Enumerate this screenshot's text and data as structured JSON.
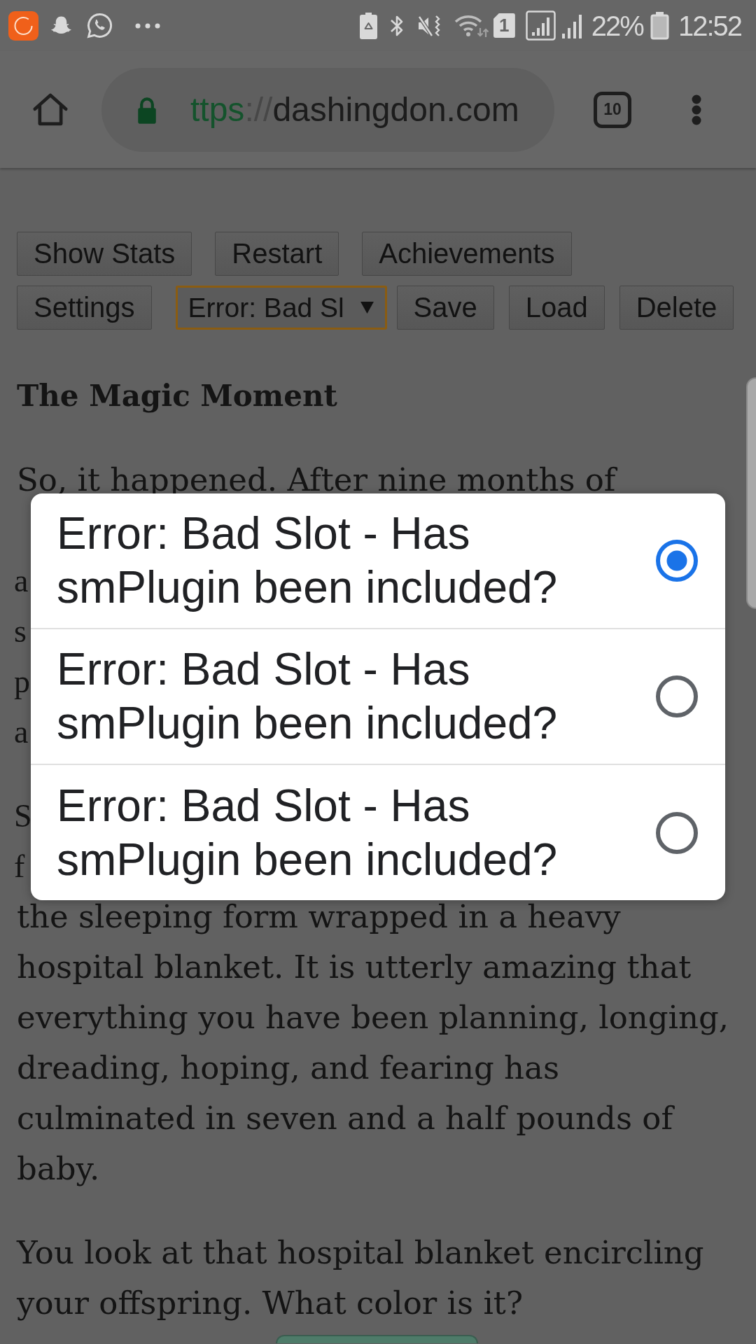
{
  "status_bar": {
    "sim_slot": "1",
    "battery": "22%",
    "time": "12:52"
  },
  "browser": {
    "url": {
      "scheme": "ttps",
      "separator": "://",
      "host": "dashingdon.com"
    },
    "tab_count": "10"
  },
  "game_controls": {
    "rows": [
      [
        {
          "kind": "button",
          "label": "Show Stats"
        },
        {
          "kind": "button",
          "label": "Restart"
        },
        {
          "kind": "button",
          "label": "Achievements"
        }
      ],
      [
        {
          "kind": "button",
          "label": "Settings"
        },
        {
          "kind": "select",
          "value": "Error: Bad Sl",
          "focused": true
        },
        {
          "kind": "button",
          "label": "Save"
        },
        {
          "kind": "button",
          "label": "Load"
        },
        {
          "kind": "button",
          "label": "Delete"
        }
      ]
    ]
  },
  "story": {
    "title": "The Magic Moment",
    "paragraphs": [
      {
        "blocks": [
          {
            "kind": "text",
            "lines": [
              "So, it happened. After nine months of"
            ]
          },
          {
            "kind": "covered",
            "rows": [
              {},
              {
                "left": "a"
              },
              {
                "left": "s"
              },
              {
                "left": "p"
              },
              {
                "left": "a"
              }
            ]
          }
        ]
      },
      {
        "blocks": [
          {
            "kind": "covered",
            "rows": [
              {
                "left": "S"
              },
              {
                "left": "f"
              }
            ]
          },
          {
            "kind": "text",
            "lines": [
              "the sleeping form wrapped in a heavy",
              "hospital blanket. It is utterly amazing that",
              "everything you have been planning, longing,",
              "dreading, hoping, and fearing has",
              "culminated in seven and a half pounds of",
              "baby."
            ]
          }
        ]
      },
      {
        "blocks": [
          {
            "kind": "text",
            "lines": [
              "You look at that hospital blanket encircling",
              "your offspring. What color is it?"
            ]
          }
        ]
      }
    ]
  },
  "dialog": {
    "options": [
      {
        "label": "Error: Bad Slot - Has smPlugin been included?",
        "selected": true
      },
      {
        "label": "Error: Bad Slot - Has smPlugin been included?",
        "selected": false
      },
      {
        "label": "Error: Bad Slot - Has smPlugin been included?",
        "selected": false
      }
    ]
  }
}
